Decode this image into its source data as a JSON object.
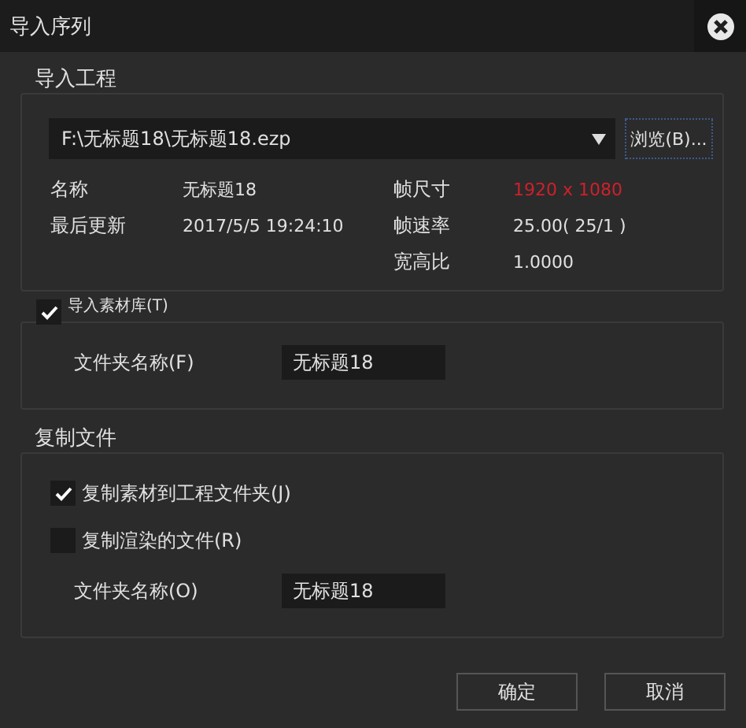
{
  "window": {
    "title": "导入序列"
  },
  "import_project": {
    "title": "导入工程",
    "path": "F:\\无标题18\\无标题18.ezp",
    "browse_button": "浏览(B)...",
    "left_info": [
      {
        "label": "名称",
        "value": "无标题18",
        "warning": false
      },
      {
        "label": "最后更新",
        "value": "2017/5/5 19:24:10",
        "warning": false
      }
    ],
    "right_info": [
      {
        "label": "帧尺寸",
        "value": "1920 x 1080",
        "warning": true
      },
      {
        "label": "帧速率",
        "value": "25.00( 25/1 )",
        "warning": false
      },
      {
        "label": "宽高比",
        "value": "1.0000",
        "warning": false
      }
    ]
  },
  "import_bin": {
    "label": "导入素材库(T)",
    "checked": true,
    "folder_label": "文件夹名称(F)",
    "folder_value": "无标题18"
  },
  "copy_files": {
    "title": "复制文件",
    "options": [
      {
        "label": "复制素材到工程文件夹(J)",
        "checked": true
      },
      {
        "label": "复制渲染的文件(R)",
        "checked": false
      }
    ],
    "folder_label": "文件夹名称(O)",
    "folder_value": "无标题18"
  },
  "buttons": [
    "确定",
    "取消"
  ]
}
